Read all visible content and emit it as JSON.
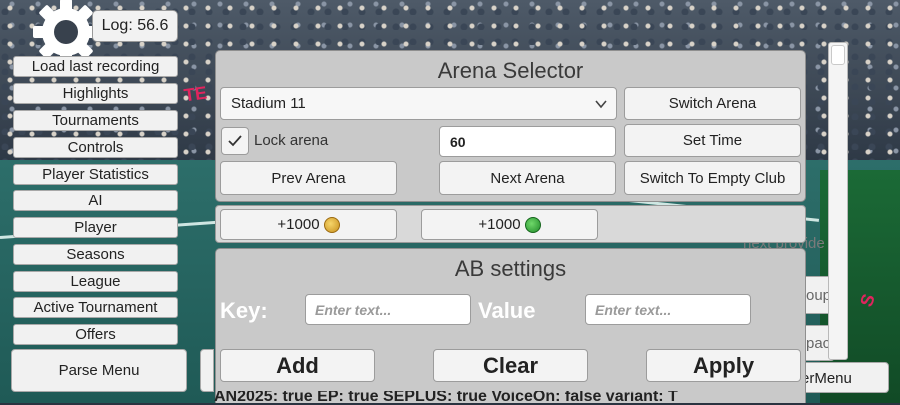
{
  "log": {
    "label": "Log: 56.6"
  },
  "left_menu": [
    "Load last recording",
    "Highlights",
    "Tournaments",
    "Controls",
    "Player Statistics",
    "AI",
    "Player",
    "Seasons",
    "League",
    "Active Tournament",
    "Offers"
  ],
  "parse_menu_label": "Parse Menu",
  "right_side": {
    "next_provider": "next provide",
    "group_fragment": "oup",
    "place_fragment": "pace",
    "menu_fragment": "erMenu"
  },
  "background": {
    "banner_top": "TE",
    "banner_right": "S"
  },
  "arena": {
    "title": "Arena Selector",
    "selected_stadium": "Stadium 11",
    "switch_arena": "Switch Arena",
    "lock_arena": "Lock arena",
    "lock_checked": true,
    "time_value": "60",
    "set_time": "Set Time",
    "prev_arena": "Prev Arena",
    "next_arena": "Next Arena",
    "switch_empty": "Switch To Empty Club"
  },
  "coins": {
    "gold_label": "+1000",
    "green_label": "+1000"
  },
  "ab": {
    "title": "AB settings",
    "key_label": "Key:",
    "key_placeholder": "Enter text...",
    "value_label": "Value",
    "value_placeholder": "Enter text...",
    "add": "Add",
    "clear": "Clear",
    "apply": "Apply"
  },
  "status_line": "AN2025: true  EP: true  SEPLUS: true  VoiceOn: false  variant: T",
  "colors": {
    "panel_bg": "#c9c9c9",
    "button_bg": "#f3f3f3",
    "court": "#2d6e6a",
    "banner": "#e0245e"
  }
}
